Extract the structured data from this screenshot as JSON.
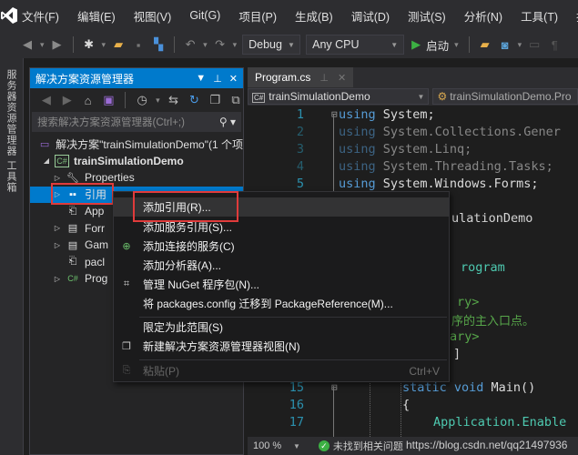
{
  "menubar": {
    "items": [
      "文件(F)",
      "编辑(E)",
      "视图(V)",
      "Git(G)",
      "项目(P)",
      "生成(B)",
      "调试(D)",
      "测试(S)",
      "分析(N)",
      "工具(T)",
      "扩展"
    ]
  },
  "toolbar": {
    "configuration": "Debug",
    "platform": "Any CPU",
    "start_label": "启动"
  },
  "left_strip": {
    "tabs": [
      "服务器资源管理器",
      "工具箱"
    ]
  },
  "solution_explorer": {
    "title": "解决方案资源管理器",
    "search_placeholder": "搜索解决方案资源管理器(Ctrl+;)",
    "tree": [
      {
        "label": "解决方案\"trainSimulationDemo\"(1 个项",
        "level": 0
      },
      {
        "label": "trainSimulationDemo",
        "level": 1
      },
      {
        "label": "Properties",
        "level": 2
      },
      {
        "label": "引用",
        "level": 2,
        "selected": true
      },
      {
        "label": "App",
        "level": 2
      },
      {
        "label": "Forr",
        "level": 2
      },
      {
        "label": "Gam",
        "level": 2
      },
      {
        "label": "pacl",
        "level": 2
      },
      {
        "label": "Prog",
        "level": 2
      }
    ]
  },
  "editor": {
    "tab": "Program.cs",
    "nav_project": "trainSimulationDemo",
    "nav_class": "trainSimulationDemo.Pro",
    "lines": [
      {
        "n": "1",
        "kw": "using",
        "rest": " System;"
      },
      {
        "n": "2",
        "kw": "using",
        "rest": " System.Collections.Gener"
      },
      {
        "n": "3",
        "kw": "using",
        "rest": " System.Linq;"
      },
      {
        "n": "4",
        "kw": "using",
        "rest": " System.Threading.Tasks;"
      },
      {
        "n": "5",
        "kw": "using",
        "rest": " System.Windows.Forms;"
      }
    ],
    "visible_fragments": {
      "namespace_tail": "ulationDemo",
      "class_tail": "rogram",
      "summary_open": "ry>",
      "comment_text": "序的主入口点。",
      "summary_close": "ary>",
      "attr_close": "]"
    },
    "lower_lines": [
      {
        "n": "15",
        "text": "static void Main()"
      },
      {
        "n": "16",
        "text": "{"
      },
      {
        "n": "17",
        "text": "Application.Enable"
      }
    ],
    "zoom": "100 %",
    "issues": "未找到相关问题"
  },
  "context_menu": {
    "items": [
      {
        "label": "添加引用(R)...",
        "icon": ""
      },
      {
        "label": "添加服务引用(S)...",
        "icon": ""
      },
      {
        "label": "添加连接的服务(C)",
        "icon": "connected-service-icon"
      },
      {
        "label": "添加分析器(A)...",
        "icon": ""
      },
      {
        "label": "管理 NuGet 程序包(N)...",
        "icon": "nuget-icon"
      },
      {
        "label": "将 packages.config 迁移到 PackageReference(M)...",
        "icon": ""
      },
      {
        "label": "限定为此范围(S)",
        "icon": ""
      },
      {
        "label": "新建解决方案资源管理器视图(N)",
        "icon": "new-view-icon"
      },
      {
        "label": "粘贴(P)",
        "icon": "paste-icon",
        "shortcut": "Ctrl+V",
        "disabled": true
      }
    ]
  },
  "watermark": "https://blog.csdn.net/qq21497936"
}
